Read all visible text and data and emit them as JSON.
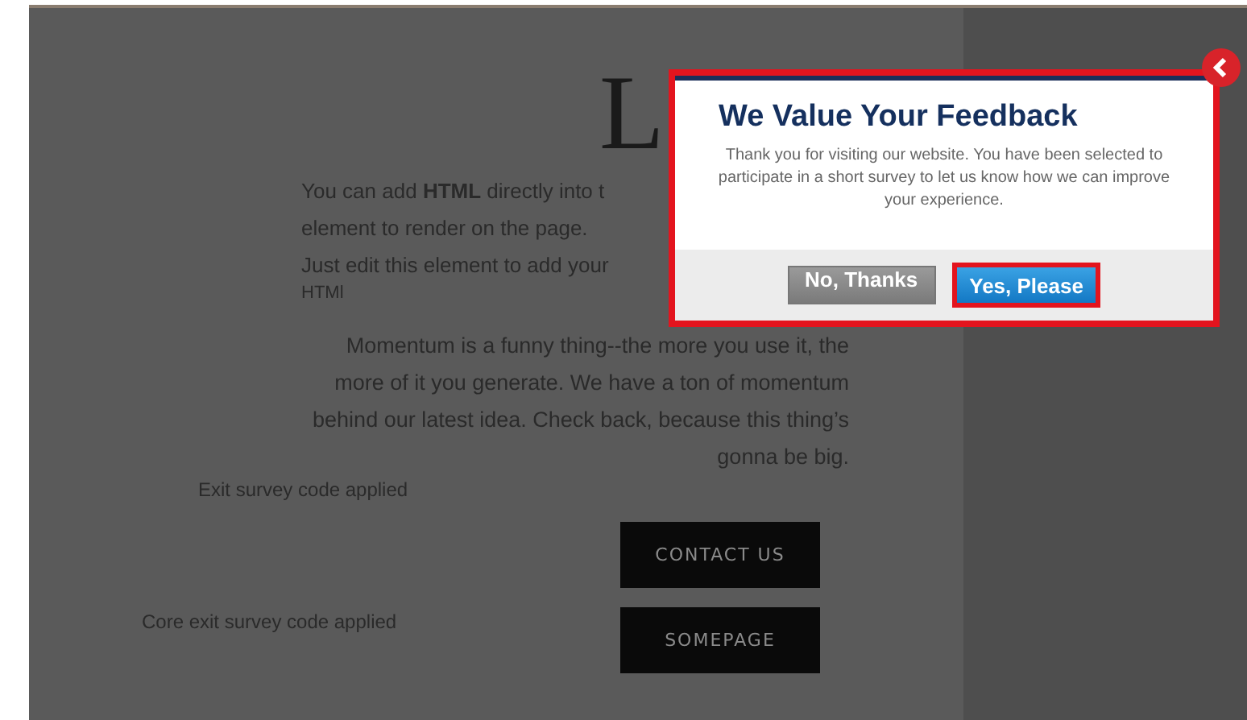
{
  "page": {
    "heading": "L",
    "intro_lines": [
      "You can add **HTML** directly into t",
      "element to render on the page.",
      "Just edit this element to add your",
      "HTMl"
    ],
    "body_lines": [
      "Momentum is a funny thing--the more you use it, the",
      "more of it you generate. We have a ton of momentum",
      "behind our latest idea. Check back, because this thing’s",
      "gonna be big."
    ],
    "sections": [
      {
        "note": "Exit survey code applied",
        "button": "CONTACT US"
      },
      {
        "note": "Core exit survey code applied",
        "button": "SOMEPAGE"
      }
    ]
  },
  "modal": {
    "title": "We Value Your Feedback",
    "message": "Thank you for visiting our website. You have been selected to participate in a short survey to let us know how we can improve your experience.",
    "buttons": [
      {
        "label": "No, Thanks",
        "kind": "secondary",
        "selected": false
      },
      {
        "label": "Yes, Please",
        "kind": "primary",
        "selected": true
      }
    ]
  }
}
